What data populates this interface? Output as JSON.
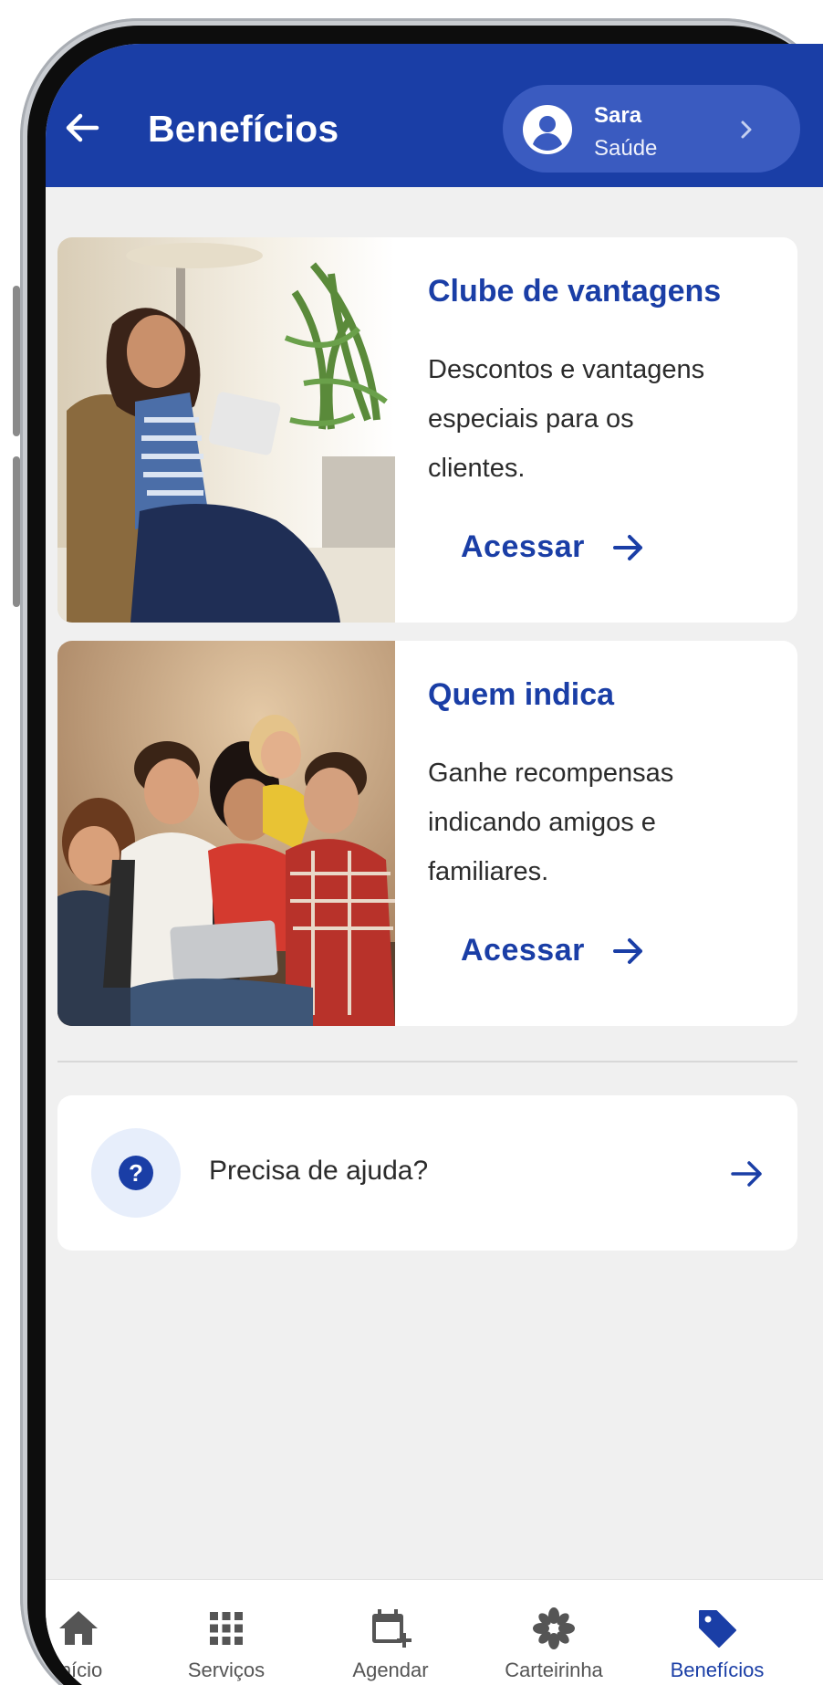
{
  "header": {
    "title": "Benefícios",
    "profile": {
      "name": "Sara",
      "plan": "Saúde"
    }
  },
  "cards": [
    {
      "title": "Clube de vantagens",
      "description": "Descontos e vantagens especiais para os clientes.",
      "action": "Acessar"
    },
    {
      "title": "Quem indica",
      "description": "Ganhe recompensas indicando amigos e familiares.",
      "action": "Acessar"
    }
  ],
  "help": {
    "label": "Precisa de ajuda?",
    "icon": "question-icon"
  },
  "bottom_nav": {
    "items": [
      {
        "label": "Início",
        "icon": "home-icon"
      },
      {
        "label": "Serviços",
        "icon": "grid-icon"
      },
      {
        "label": "Agendar",
        "icon": "calendar-add-icon"
      },
      {
        "label": "Carteirinha",
        "icon": "card-icon"
      },
      {
        "label": "Benefícios",
        "icon": "tag-icon",
        "active": true
      }
    ]
  },
  "colors": {
    "brand": "#1a3ea6",
    "pill": "#3a5bc0",
    "background": "#f0f0f0"
  }
}
